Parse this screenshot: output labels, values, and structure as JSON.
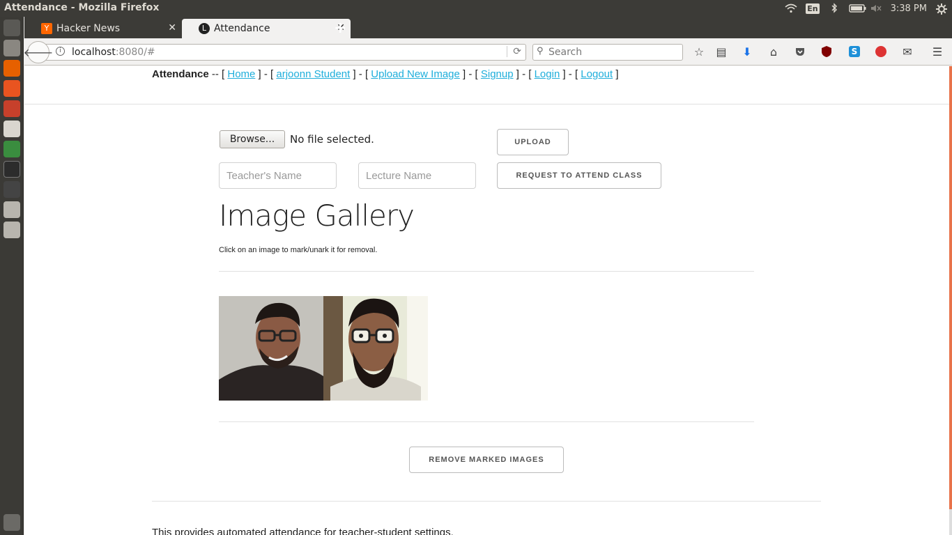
{
  "window": {
    "title": "Attendance - Mozilla Firefox"
  },
  "tray": {
    "keyboard": "En",
    "clock": "3:38 PM"
  },
  "tabs": [
    {
      "label": "Hacker News",
      "active": false,
      "favicon_color": "#ff6600",
      "favicon_text": "Y"
    },
    {
      "label": "Attendance",
      "active": true,
      "favicon_color": "#222222",
      "favicon_text": "L"
    }
  ],
  "navbar": {
    "url_host": "localhost",
    "url_rest": ":8080/#",
    "search_placeholder": "Search"
  },
  "site_nav": {
    "brand": "Attendance",
    "sep_after_brand": " -- [ ",
    "links": [
      "Home",
      "arjoonn Student",
      "Upload New Image",
      "Signup",
      "Login",
      "Logout"
    ],
    "sep_between": " ] - [ ",
    "sep_end": " ]",
    "link_color": "#1eaedb"
  },
  "upload_form": {
    "browse_label": "Browse...",
    "file_status": "No file selected.",
    "upload_label": "UPLOAD",
    "teacher_placeholder": "Teacher's Name",
    "lecture_placeholder": "Lecture Name",
    "request_label": "REQUEST TO ATTEND CLASS"
  },
  "gallery": {
    "title": "Image Gallery",
    "hint": "Click on an image to mark/unark it for removal.",
    "image_count": 2,
    "remove_label": "REMOVE MARKED IMAGES"
  },
  "footer": {
    "text": "This provides automated attendance for teacher-student settings."
  },
  "colors": {
    "scroll_accent": "#e8734a",
    "panel": "#3c3b37"
  }
}
